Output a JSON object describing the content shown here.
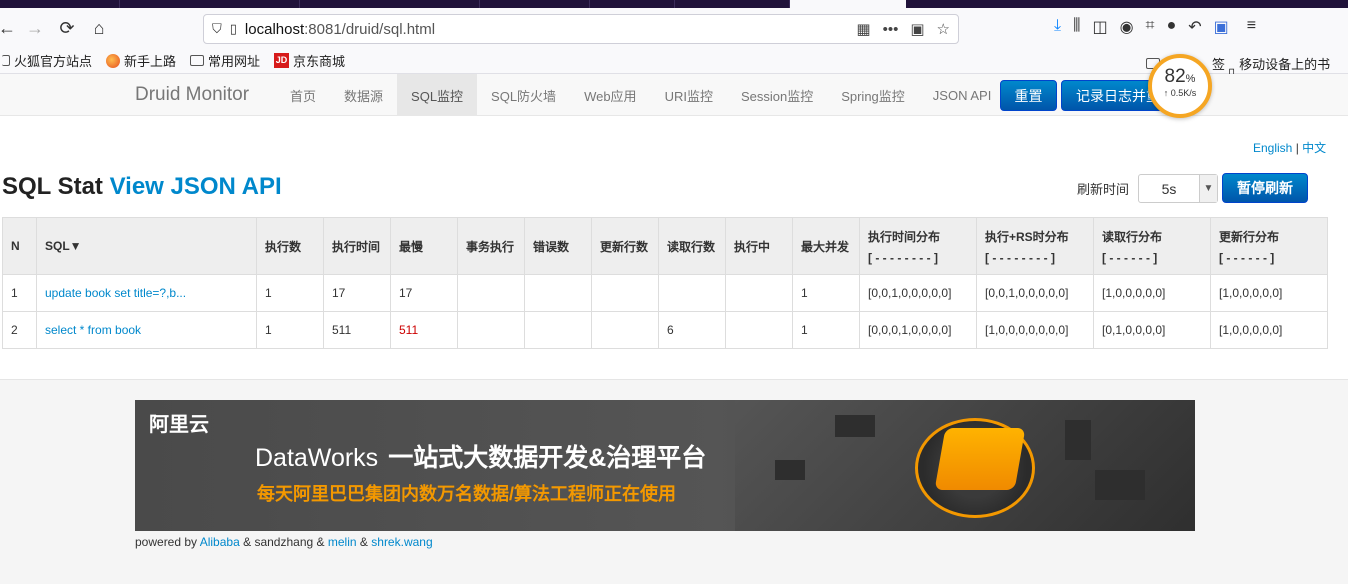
{
  "browser": {
    "url_host": "localhost",
    "url_path": ":8081/druid/sql.html",
    "bookmarks": [
      "火狐官方站点",
      "新手上路",
      "常用网址",
      "京东商城"
    ],
    "bookmark_right": "移动设备上的书签",
    "bookmark_right_partial": "签"
  },
  "speed_widget": {
    "percent": "82",
    "unit": "%",
    "rate": "↑ 0.5K/s"
  },
  "druid": {
    "brand": "Druid Monitor",
    "menu": [
      "首页",
      "数据源",
      "SQL监控",
      "SQL防火墙",
      "Web应用",
      "URI监控",
      "Session监控",
      "Spring监控",
      "JSON API"
    ],
    "active_menu_index": 2,
    "reset_button": "重置",
    "log_button": "记录日志并重置"
  },
  "page": {
    "lang_en": "English",
    "lang_sep": "|",
    "lang_zh": "中文",
    "title": "SQL Stat",
    "title_link": "View JSON API",
    "refresh_label": "刷新时间",
    "refresh_value": "5s",
    "pause_button": "暂停刷新"
  },
  "table": {
    "headers": [
      "N",
      "SQL▼",
      "执行数",
      "执行时间",
      "最慢",
      "事务执行",
      "错误数",
      "更新行数",
      "读取行数",
      "执行中",
      "最大并发",
      "执行时间分布",
      "执行+RS时分布",
      "读取行分布",
      "更新行分布"
    ],
    "header_subs": [
      "[ - - - - - - - - ]",
      "[ - - - - - - - - ]",
      "[ - - - - - - ]",
      "[ - - - - - - ]"
    ],
    "rows": [
      [
        "1",
        "update book set title=?,b...",
        "1",
        "17",
        "17",
        "",
        "",
        "",
        "",
        "",
        "1",
        "[0,0,1,0,0,0,0,0]",
        "[0,0,1,0,0,0,0,0]",
        "[1,0,0,0,0,0]",
        "[1,0,0,0,0,0]"
      ],
      [
        "2",
        "select * from book",
        "1",
        "511",
        "511",
        "",
        "",
        "",
        "6",
        "",
        "1",
        "[0,0,0,1,0,0,0,0]",
        "[1,0,0,0,0,0,0,0]",
        "[0,1,0,0,0,0]",
        "[1,0,0,0,0,0]"
      ]
    ]
  },
  "footer": {
    "banner_brand": "阿里云",
    "banner_product": "DataWorks",
    "banner_slogan": "一站式大数据开发&治理平台",
    "banner_sub": "每天阿里巴巴集团内数万名数据/算法工程师正在使用",
    "powered_prefix": "powered by",
    "alibaba": "Alibaba",
    "amp1": "&",
    "sandzhang": "sandzhang",
    "amp2": "&",
    "melin": "melin",
    "amp3": "&",
    "shrek": "shrek.wang"
  }
}
